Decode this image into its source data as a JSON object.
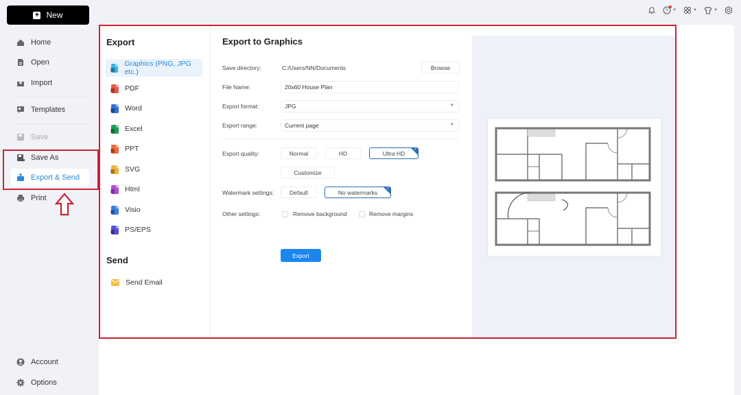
{
  "sidebar": {
    "new_label": "New",
    "items": [
      {
        "label": "Home",
        "icon": "home-icon",
        "state": "normal"
      },
      {
        "label": "Open",
        "icon": "file-icon",
        "state": "normal"
      },
      {
        "label": "Import",
        "icon": "import-icon",
        "state": "normal"
      },
      {
        "label": "Templates",
        "icon": "templates-icon",
        "state": "normal"
      },
      {
        "label": "Save",
        "icon": "save-icon",
        "state": "disabled"
      },
      {
        "label": "Save As",
        "icon": "save-as-icon",
        "state": "normal"
      },
      {
        "label": "Export & Send",
        "icon": "export-icon",
        "state": "active"
      },
      {
        "label": "Print",
        "icon": "print-icon",
        "state": "normal"
      }
    ],
    "bottom_items": [
      {
        "label": "Account",
        "icon": "account-icon"
      },
      {
        "label": "Options",
        "icon": "gear-icon"
      }
    ]
  },
  "top_bar": {
    "icons": [
      "bell-icon",
      "help-icon",
      "apps-icon",
      "theme-shirt-icon",
      "settings-icon"
    ]
  },
  "export_list": {
    "export_heading": "Export",
    "items": [
      {
        "label": "Graphics (PNG, JPG etc.)",
        "color": "#3bb3e6",
        "active": true
      },
      {
        "label": "PDF",
        "color": "#e8594a"
      },
      {
        "label": "Word",
        "color": "#2f6fd8"
      },
      {
        "label": "Excel",
        "color": "#1f9d55"
      },
      {
        "label": "PPT",
        "color": "#ef6b3a"
      },
      {
        "label": "SVG",
        "color": "#f1b43a"
      },
      {
        "label": "Html",
        "color": "#b24fd8"
      },
      {
        "label": "Visio",
        "color": "#3a7fe0"
      },
      {
        "label": "PS/EPS",
        "color": "#5a4fd8"
      }
    ],
    "send_heading": "Send",
    "send_items": [
      {
        "label": "Send Email",
        "color": "#f5c04a"
      }
    ]
  },
  "panel": {
    "title": "Export to Graphics",
    "save_directory_label": "Save directory:",
    "save_directory_value": "C:/Users/NN/Documents",
    "browse_label": "Browse",
    "file_name_label": "File Name:",
    "file_name_value": "20x60 House Plan",
    "export_format_label": "Export format:",
    "export_format_value": "JPG",
    "export_range_label": "Export range:",
    "export_range_value": "Current page",
    "export_quality_label": "Export quality:",
    "quality_options": [
      "Normal",
      "HD",
      "Ultra HD"
    ],
    "quality_selected": "Ultra HD",
    "customize_label": "Customize",
    "watermark_label": "Watermark settings:",
    "watermark_options": [
      "Default",
      "No watermarks"
    ],
    "watermark_selected": "No watermarks",
    "other_settings_label": "Other settings:",
    "remove_background_label": "Remove background",
    "remove_background_checked": false,
    "remove_margins_label": "Remove margins",
    "remove_margins_checked": false,
    "export_button_label": "Export"
  },
  "colors": {
    "accent": "#2b88d8",
    "primary_button": "#1c86f0",
    "annotation": "#cc2233"
  }
}
